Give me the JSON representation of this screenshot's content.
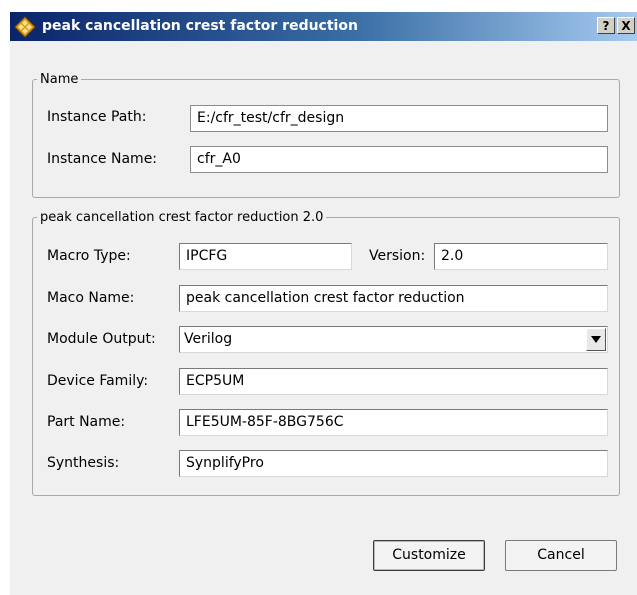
{
  "window": {
    "title": "peak cancellation crest factor reduction",
    "help_label": "?",
    "close_label": "X"
  },
  "name_group": {
    "legend": "Name",
    "instance_path_label": "Instance Path:",
    "instance_path_value": "E:/cfr_test/cfr_design",
    "instance_name_label": "Instance Name:",
    "instance_name_value": "cfr_A0"
  },
  "config_group": {
    "legend": "peak cancellation crest factor reduction 2.0",
    "macro_type_label": "Macro Type:",
    "macro_type_value": "IPCFG",
    "version_label": "Version:",
    "version_value": "2.0",
    "macro_name_label": "Maco Name:",
    "macro_name_value": "peak cancellation crest factor reduction",
    "module_output_label": "Module Output:",
    "module_output_value": "Verilog",
    "device_family_label": "Device Family:",
    "device_family_value": "ECP5UM",
    "part_name_label": "Part Name:",
    "part_name_value": "LFE5UM-85F-8BG756C",
    "synthesis_label": "Synthesis:",
    "synthesis_value": "SynplifyPro"
  },
  "buttons": {
    "customize_label": "Customize",
    "cancel_label": "Cancel"
  },
  "icons": {
    "title_icon": "diamond-logo-icon",
    "dropdown_icon": "chevron-down-icon"
  },
  "colors": {
    "titlebar_start": "#0a246a",
    "titlebar_end": "#a6caf0",
    "dialog_bg": "#f0f0f0"
  }
}
